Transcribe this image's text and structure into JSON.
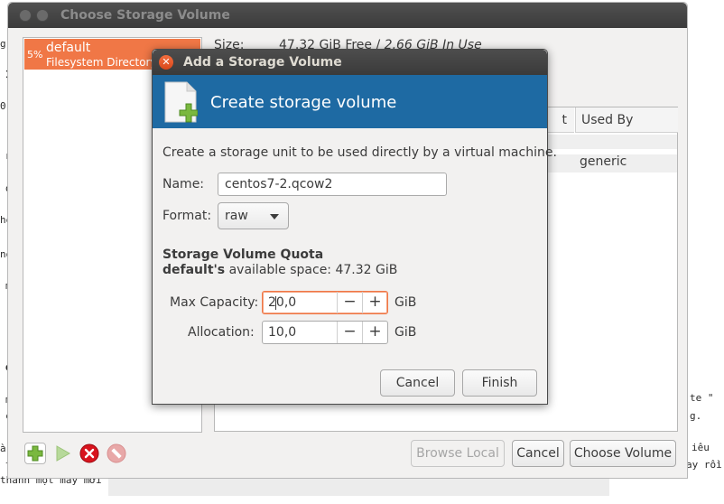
{
  "background": {
    "fragments": [
      "g",
      "I",
      "0",
      "r",
      "d",
      "hê",
      "ng",
      "m",
      "q",
      "m",
      "c",
      "à",
      "t",
      "thành một máy mới",
      "te \"",
      "g.",
      "iêu",
      "ay rồi"
    ]
  },
  "parent_window": {
    "title": "Choose Storage Volume",
    "pool": {
      "percent": "5%",
      "name": "default",
      "type": "Filesystem Directory"
    },
    "size_label": "Size:",
    "size_free": "47.32 GiB Free /",
    "size_in_use": "2.66 GiB In Use",
    "columns": [
      "t",
      "Used By"
    ],
    "volume_used_by": "generic",
    "buttons": {
      "browse_local": "Browse Local",
      "cancel": "Cancel",
      "choose_volume": "Choose Volume"
    }
  },
  "dialog": {
    "title": "Add a Storage Volume",
    "header": "Create storage volume",
    "description": "Create a storage unit to be used directly by a virtual machine.",
    "name_label": "Name:",
    "name_value": "centos7-2.qcow2",
    "format_label": "Format:",
    "format_value": "raw",
    "quota_heading": "Storage Volume Quota",
    "space_pool": "default's",
    "space_text": "available space: 47.32 GiB",
    "max_capacity_label": "Max Capacity:",
    "max_capacity_value": "20,0",
    "allocation_label": "Allocation:",
    "allocation_value": "10,0",
    "unit": "GiB",
    "minus_glyph": "−",
    "plus_glyph": "+",
    "cancel_button": "Cancel",
    "finish_button": "Finish"
  },
  "colors": {
    "accent": "#f07746",
    "banner": "#1e6aa3",
    "titlebar": "#3b3b3b",
    "close": "#e05a2b"
  },
  "icons": [
    "close-icon",
    "storage-volume-icon",
    "add-icon",
    "start-icon",
    "stop-icon",
    "delete-icon",
    "minus-icon",
    "plus-icon",
    "chevron-down-icon"
  ]
}
